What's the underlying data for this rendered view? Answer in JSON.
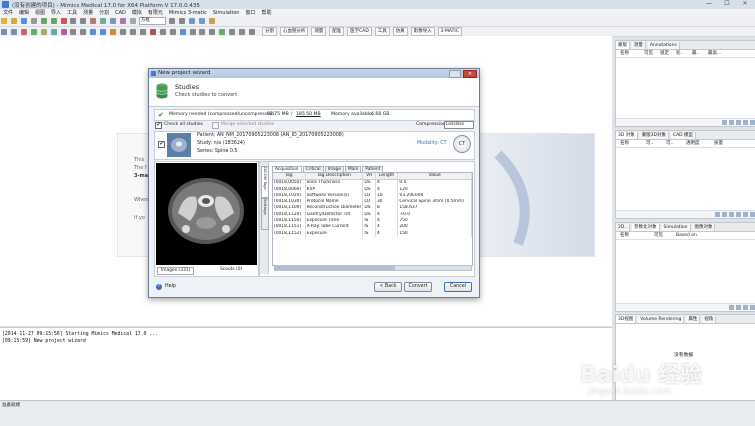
{
  "app": {
    "title": "(没有创建的项目) - Mimics Medical 17.0 for X64 Platform V 17.0.0.435",
    "window_buttons": [
      "—",
      "☐",
      "✕"
    ]
  },
  "menu": [
    "文件",
    "编辑",
    "视图",
    "导入",
    "工具",
    "测量",
    "分割",
    "CAD",
    "模拟",
    "有限元",
    "Mimics 3-matic",
    "Simulation",
    "窗口",
    "帮助"
  ],
  "toolbar": {
    "combo_value": "方框",
    "segment_tabs": [
      "分割",
      "心血管分析",
      "测量",
      "配准",
      "医学CAD",
      "工具",
      "仿真",
      "影像导入",
      "3-MATIC"
    ]
  },
  "welcome": {
    "lines": [
      "This",
      "The f",
      "3-ma",
      "When",
      "If yo"
    ]
  },
  "log": {
    "lines": [
      "[2014-11-27 09:15:56] Starting Mimics Medical 17.0 ...",
      "[09:15:59] New project wizard"
    ]
  },
  "right_panels": {
    "top": {
      "tabs": [
        "蒙版",
        "测量",
        "Annotations"
      ],
      "headers": [
        "名称",
        "可见",
        "锁定",
        "轮..",
        "最..",
        "最高..."
      ]
    },
    "mid": {
      "tabs": [
        "3D 对象",
        "蒙版3D对象",
        "CAD 模型"
      ],
      "headers": [
        "名称",
        "可..",
        "可..",
        "透明度",
        "质量"
      ]
    },
    "low": {
      "tabs": [
        "2D..",
        "参数化对象",
        "Simulation",
        "图像对象"
      ],
      "headers": [
        "名称",
        "可见",
        "Based on"
      ]
    },
    "bottom": {
      "tabs": [
        "3D视图",
        "Volume Rendering",
        "属性",
        "视角"
      ],
      "label": "没有数据"
    }
  },
  "status": {
    "text": "准备就绪"
  },
  "dialog": {
    "title": "New project wizard",
    "header_title": "Studies",
    "header_sub": "Check studies to convert",
    "memory_needed_label": "Memory needed (compressed/uncompressed):",
    "memory_needed_value": "92.75 MB",
    "memory_needed_value2": "185.50 MB",
    "memory_available_label": "Memory available:",
    "memory_available_value": "4.68 GB",
    "check_all": "Check all studies",
    "merge": "Merge selected studies",
    "compression_label": "Compression",
    "compression_value": "Lossless",
    "patient": "Patient: AN_NM_20170905223008 (AN_ID_20170905223008)",
    "study": "Study: n/a (183624)",
    "series": "Series: Spine 0.5",
    "modality": "Modality: CT",
    "image_tabs": [
      "Images (331)",
      "Scouts (0)"
    ],
    "side_tabs": [
      "DICOM Tags",
      "Settings"
    ],
    "tag_tabs": [
      "Acquisition",
      "Critical",
      "Image",
      "Main",
      "Patient"
    ],
    "table_headers": [
      "Tag",
      "Tag Description",
      "VR",
      "Length",
      "Value"
    ],
    "table_rows": [
      [
        "(0018,0050)",
        "Slice Thickness",
        "DS",
        "4",
        "0.5"
      ],
      [
        "(0018,0060)",
        "KVP",
        "DS",
        "4",
        "120"
      ],
      [
        "(0018,1020)",
        "Software Version(s)",
        "LO",
        "10",
        "V3.20E006"
      ],
      [
        "(0018,1030)",
        "Protocol Name",
        "LO",
        "30",
        "Cervical Spine 3mm (0.5mm)"
      ],
      [
        "(0018,1100)",
        "Reconstruction Diameter",
        "DS",
        "8",
        "158.637"
      ],
      [
        "(0018,1120)",
        "Gantry/Detector Tilt",
        "DS",
        "4",
        "+0.0"
      ],
      [
        "(0018,1150)",
        "Exposure Time",
        "IS",
        "4",
        "750"
      ],
      [
        "(0018,1151)",
        "X-Ray Tube Current",
        "IS",
        "4",
        "200"
      ],
      [
        "(0018,1152)",
        "Exposure",
        "IS",
        "4",
        "150"
      ]
    ],
    "help": "Help",
    "back": "< Back",
    "convert": "Convert",
    "cancel": "Cancel"
  },
  "watermark": {
    "text": "Baidu 经验",
    "sub": "jingyan.baidu.com"
  }
}
